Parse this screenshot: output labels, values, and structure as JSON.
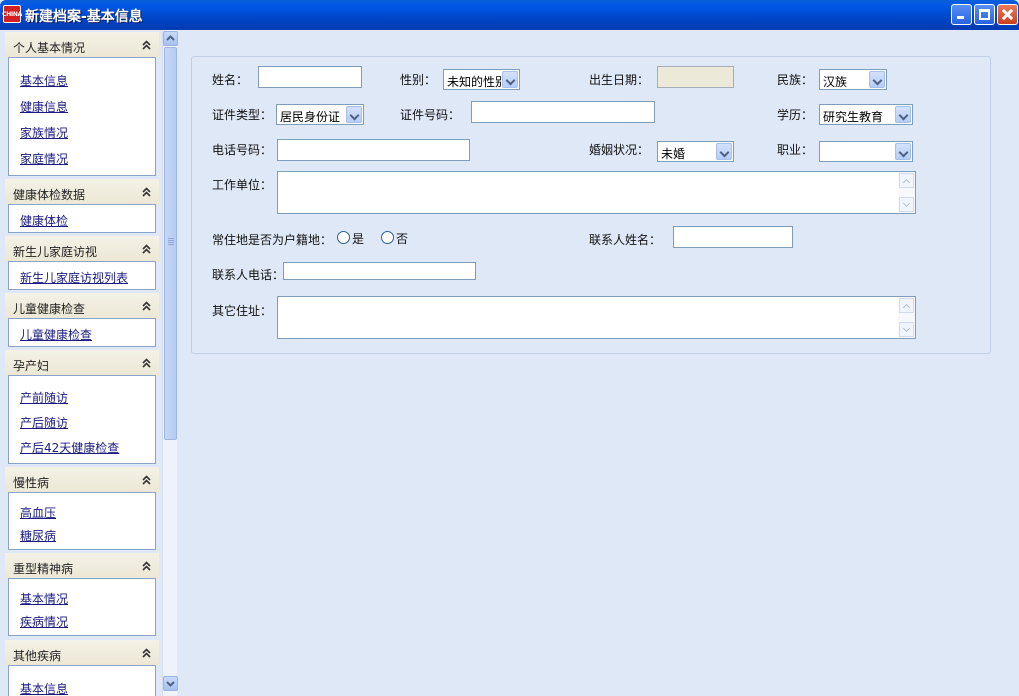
{
  "window": {
    "title": "新建档案-基本信息",
    "app_icon_text": "CHINA"
  },
  "sidebar": {
    "groups": [
      {
        "title": "个人基本情况",
        "items": [
          "基本信息",
          "健康信息",
          "家族情况",
          "家庭情况"
        ]
      },
      {
        "title": "健康体检数据",
        "items": [
          "健康体检"
        ]
      },
      {
        "title": "新生儿家庭访视",
        "items": [
          "新生儿家庭访视列表"
        ]
      },
      {
        "title": "儿童健康检查",
        "items": [
          "儿童健康检查"
        ]
      },
      {
        "title": "孕产妇",
        "items": [
          "产前随访",
          "产后随访",
          "产后42天健康检查"
        ]
      },
      {
        "title": "慢性病",
        "items": [
          "高血压",
          "糖尿病"
        ]
      },
      {
        "title": "重型精神病",
        "items": [
          "基本情况",
          "疾病情况"
        ]
      },
      {
        "title": "其他疾病",
        "items": [
          "基本信息"
        ]
      }
    ]
  },
  "form": {
    "name_label": "姓名：",
    "name_value": "",
    "gender_label": "性别：",
    "gender_value": "未知的性别",
    "birth_label": "出生日期：",
    "birth_value": "",
    "ethnicity_label": "民族：",
    "ethnicity_value": "汉族",
    "idtype_label": "证件类型：",
    "idtype_value": "居民身份证",
    "idno_label": "证件号码：",
    "idno_value": "",
    "education_label": "学历：",
    "education_value": "研究生教育",
    "phone_label": "电话号码：",
    "phone_value": "",
    "marital_label": "婚姻状况：",
    "marital_value": "未婚",
    "occupation_label": "职业：",
    "occupation_value": "",
    "workplace_label": "工作单位：",
    "residence_label": "常住地是否为户籍地：",
    "residence_yes": "是",
    "residence_no": "否",
    "contact_name_label": "联系人姓名：",
    "contact_phone_label": "联系人电话：",
    "other_address_label": "其它住址："
  }
}
